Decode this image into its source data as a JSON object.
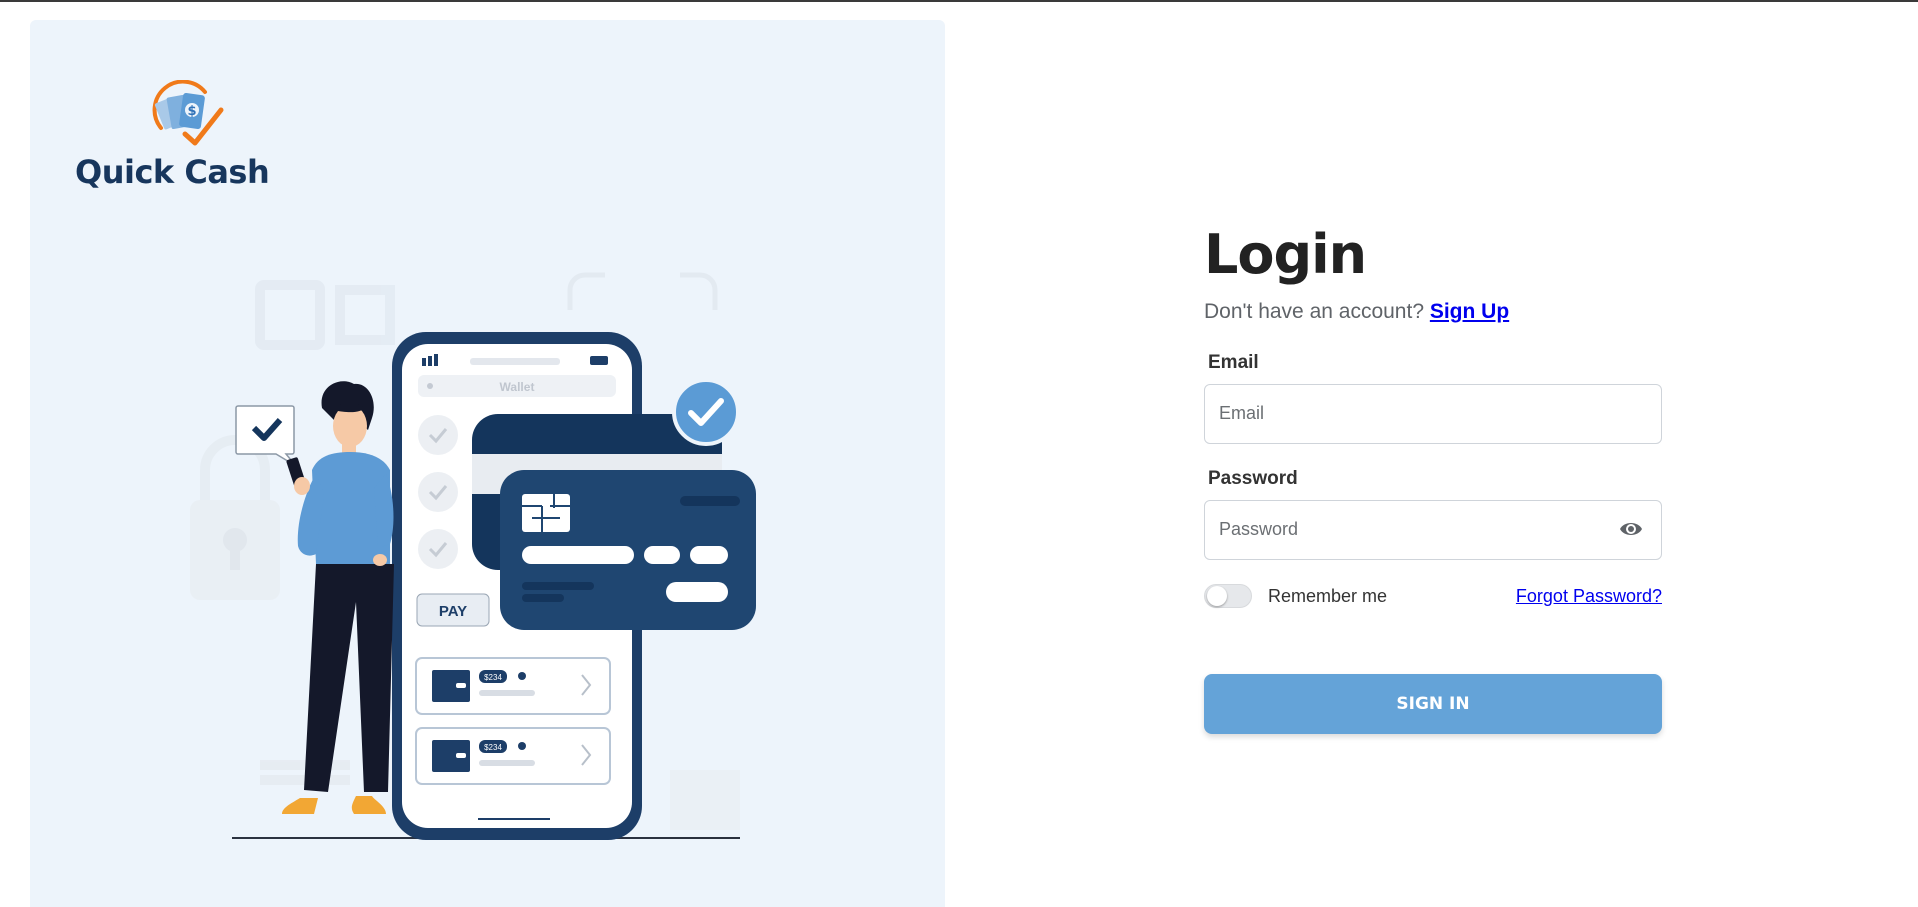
{
  "brand": {
    "name": "Quick Cash",
    "logo_icon": "money-check-logo-icon",
    "accent": "#f07a1a",
    "primary": "#17365d"
  },
  "illustration": {
    "wallet_label": "Wallet",
    "pay_label": "PAY",
    "transactions": [
      {
        "amount": "$234"
      },
      {
        "amount": "$234"
      }
    ]
  },
  "login": {
    "title": "Login",
    "signup_prompt": "Don't have an account?",
    "signup_link": "Sign Up",
    "email_label": "Email",
    "email_placeholder": "Email",
    "email_value": "",
    "password_label": "Password",
    "password_placeholder": "Password",
    "password_value": "",
    "password_toggle_icon": "eye-icon",
    "remember_label": "Remember me",
    "remember_checked": false,
    "forgot_link": "Forgot Password?",
    "submit_label": "SIGN IN",
    "submit_color": "#64a3d8"
  }
}
